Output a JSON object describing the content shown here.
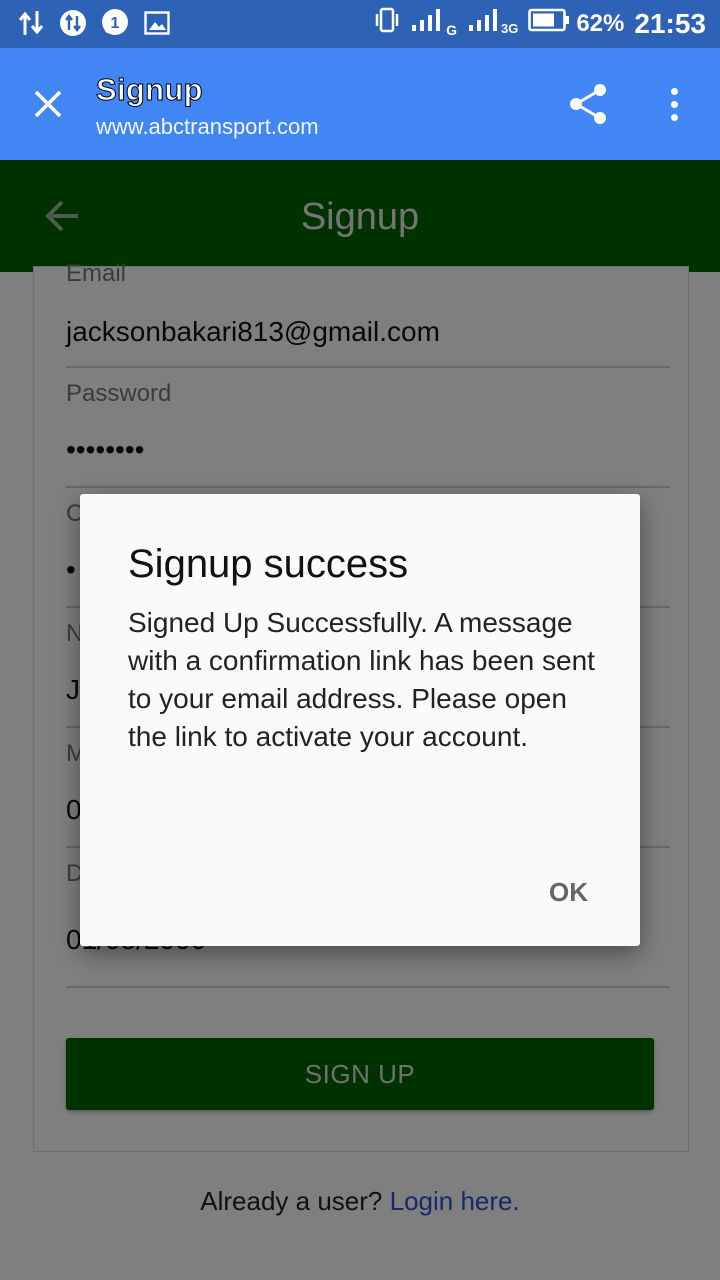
{
  "status_bar": {
    "battery": "62%",
    "time": "21:53",
    "network_g": "G",
    "network_3g": "3G"
  },
  "browser": {
    "title": "Signup",
    "url": "www.abctransport.com"
  },
  "app_bar": {
    "title": "Signup"
  },
  "form": {
    "email_label": "Email",
    "email_value": "jacksonbakari813@gmail.com",
    "password_label": "Password",
    "password_value": "••••••••",
    "confirm_label": "C",
    "confirm_value": "•",
    "name_label": "N",
    "name_value": "J",
    "mobile_label": "M",
    "mobile_value": "0",
    "dob_label": "D",
    "dob_value": "01/05/2000",
    "signup_button": "SIGN UP"
  },
  "footer": {
    "already_user": "Already a user?",
    "login_link": "Login here."
  },
  "dialog": {
    "title": "Signup success",
    "message": "Signed Up Successfully. A message with a confirmation link has been sent to your email address. Please open the link to activate your account.",
    "ok_button": "OK"
  },
  "colors": {
    "status_bar": "#2e62b6",
    "browser_bar": "#4285f4",
    "app_bar": "#006400",
    "link": "#2a52d6"
  }
}
